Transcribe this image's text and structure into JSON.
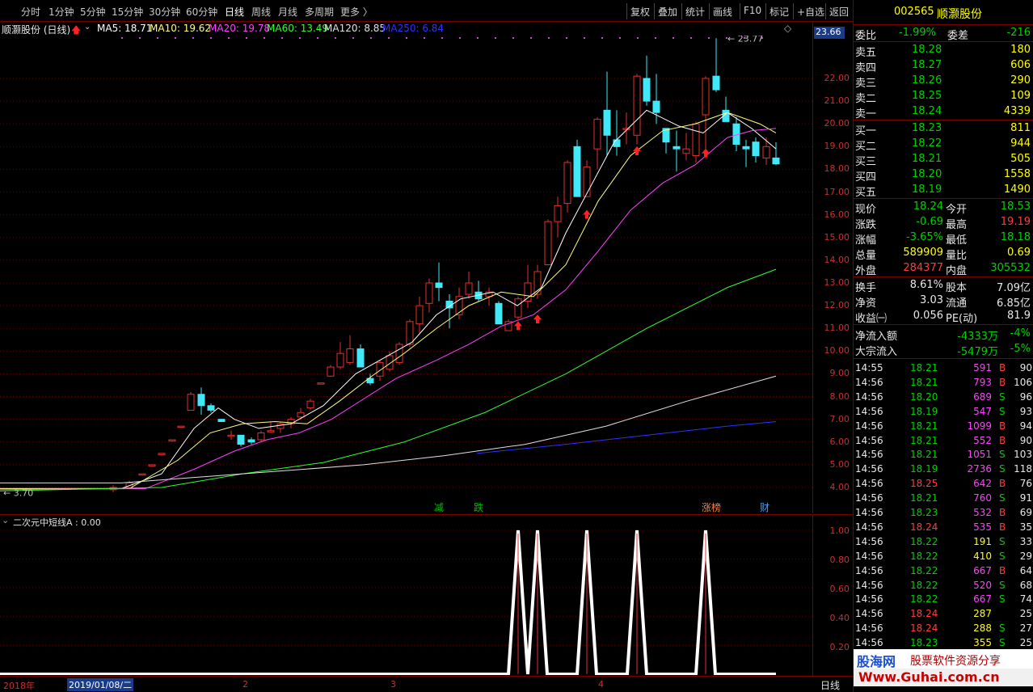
{
  "tabs": [
    "分时",
    "1分钟",
    "5分钟",
    "15分钟",
    "30分钟",
    "60分钟",
    "日线",
    "周线",
    "月线",
    "多周期",
    "更多 〉"
  ],
  "active_tab": "日线",
  "toolbar": [
    "复权",
    "叠加",
    "统计",
    "画线",
    "F10",
    "标记",
    "+自选",
    "返回"
  ],
  "info": {
    "title": "顺灏股份 (日线)",
    "ma5": "MA5: 18.71",
    "ma10": "MA10: 19.62",
    "ma20": "MA20: 19.78",
    "ma60": "MA60: 13.49",
    "ma120": "MA120: 8.85",
    "ma250": "MA250: 6.84",
    "ma_colors": {
      "ma5": "#ffffff",
      "ma10": "#ffff80",
      "ma20": "#ff40ff",
      "ma60": "#30ff30",
      "ma120": "#e0e0e0",
      "ma250": "#3030ff"
    }
  },
  "price_label": "23.66",
  "high_label": "23.77",
  "low_label": "3.70",
  "y_labels": [
    "22.00",
    "21.00",
    "20.00",
    "19.00",
    "18.00",
    "17.00",
    "16.00",
    "15.00",
    "14.00",
    "13.00",
    "12.00",
    "11.00",
    "10.00",
    "9.00",
    "8.00",
    "7.00",
    "6.00",
    "5.00",
    "4.00"
  ],
  "markers": [
    "减",
    "跌",
    "涨榜",
    "财"
  ],
  "indicator": {
    "title": "二次元中短线A : 0.00",
    "y_labels": [
      "1.00",
      "0.80",
      "0.60",
      "0.40",
      "0.20"
    ]
  },
  "bottom": {
    "year": "2018年",
    "date": "2019/01/08/二",
    "m2": "2",
    "m3": "3",
    "m4": "4",
    "period": "日线"
  },
  "panel": {
    "code": "002565",
    "name": "顺灏股份",
    "weibi": {
      "label": "委比",
      "value": "-1.99%",
      "label2": "委差",
      "value2": "-216"
    },
    "sells": [
      {
        "l": "卖五",
        "p": "18.28",
        "v": "180"
      },
      {
        "l": "卖四",
        "p": "18.27",
        "v": "606"
      },
      {
        "l": "卖三",
        "p": "18.26",
        "v": "290"
      },
      {
        "l": "卖二",
        "p": "18.25",
        "v": "109"
      },
      {
        "l": "卖一",
        "p": "18.24",
        "v": "4339"
      }
    ],
    "buys": [
      {
        "l": "买一",
        "p": "18.23",
        "v": "811"
      },
      {
        "l": "买二",
        "p": "18.22",
        "v": "944"
      },
      {
        "l": "买三",
        "p": "18.21",
        "v": "505"
      },
      {
        "l": "买四",
        "p": "18.20",
        "v": "1558"
      },
      {
        "l": "买五",
        "p": "18.19",
        "v": "1490"
      }
    ],
    "quote": [
      {
        "l1": "现价",
        "v1": "18.24",
        "c1": "dn",
        "l2": "今开",
        "v2": "18.53",
        "c2": "dn"
      },
      {
        "l1": "涨跌",
        "v1": "-0.69",
        "c1": "dn",
        "l2": "最高",
        "v2": "19.19",
        "c2": "up"
      },
      {
        "l1": "涨幅",
        "v1": "-3.65%",
        "c1": "dn",
        "l2": "最低",
        "v2": "18.18",
        "c2": "dn"
      },
      {
        "l1": "总量",
        "v1": "589909",
        "c1": "yl",
        "l2": "量比",
        "v2": "0.69",
        "c2": "yl"
      },
      {
        "l1": "外盘",
        "v1": "284377",
        "c1": "up",
        "l2": "内盘",
        "v2": "305532",
        "c2": "dn"
      }
    ],
    "stats": [
      {
        "l1": "换手",
        "v1": "8.61%",
        "l2": "股本",
        "v2": "7.09亿"
      },
      {
        "l1": "净资",
        "v1": "3.03",
        "l2": "流通",
        "v2": "6.85亿"
      },
      {
        "l1": "收益㈠",
        "v1": "0.056",
        "l2": "PE(动)",
        "v2": "81.9"
      }
    ],
    "flows": [
      {
        "l": "净流入额",
        "v": "-4333万",
        "p": "-4%"
      },
      {
        "l": "大宗流入",
        "v": "-5479万",
        "p": "-5%"
      }
    ],
    "ticks": [
      {
        "t": "14:55",
        "p": "18.21",
        "v": "591",
        "s": "B",
        "n": "90"
      },
      {
        "t": "14:56",
        "p": "18.21",
        "v": "793",
        "s": "B",
        "n": "106"
      },
      {
        "t": "14:56",
        "p": "18.20",
        "v": "689",
        "s": "S",
        "n": "96"
      },
      {
        "t": "14:56",
        "p": "18.19",
        "v": "547",
        "s": "S",
        "n": "93"
      },
      {
        "t": "14:56",
        "p": "18.21",
        "v": "1099",
        "s": "B",
        "n": "94"
      },
      {
        "t": "14:56",
        "p": "18.21",
        "v": "552",
        "s": "B",
        "n": "90"
      },
      {
        "t": "14:56",
        "p": "18.21",
        "v": "1051",
        "s": "S",
        "n": "103"
      },
      {
        "t": "14:56",
        "p": "18.19",
        "v": "2736",
        "s": "S",
        "n": "118"
      },
      {
        "t": "14:56",
        "p": "18.25",
        "v": "642",
        "s": "B",
        "n": "76"
      },
      {
        "t": "14:56",
        "p": "18.21",
        "v": "760",
        "s": "S",
        "n": "91"
      },
      {
        "t": "14:56",
        "p": "18.23",
        "v": "532",
        "s": "B",
        "n": "69"
      },
      {
        "t": "14:56",
        "p": "18.24",
        "v": "535",
        "s": "B",
        "n": "35"
      },
      {
        "t": "14:56",
        "p": "18.22",
        "v": "191",
        "s": "S",
        "n": "33"
      },
      {
        "t": "14:56",
        "p": "18.22",
        "v": "410",
        "s": "S",
        "n": "29"
      },
      {
        "t": "14:56",
        "p": "18.22",
        "v": "667",
        "s": "B",
        "n": "64"
      },
      {
        "t": "14:56",
        "p": "18.22",
        "v": "520",
        "s": "S",
        "n": "68"
      },
      {
        "t": "14:56",
        "p": "18.22",
        "v": "667",
        "s": "S",
        "n": "74"
      },
      {
        "t": "14:56",
        "p": "18.24",
        "v": "287",
        "s": "",
        "n": "25"
      },
      {
        "t": "14:56",
        "p": "18.24",
        "v": "288",
        "s": "S",
        "n": "27"
      },
      {
        "t": "14:56",
        "p": "18.23",
        "v": "355",
        "s": "S",
        "n": "25"
      }
    ],
    "watermark1": "股海网",
    "watermark2": "股票软件资源分享",
    "watermark3": "Www.Guhai.com.cn"
  }
}
